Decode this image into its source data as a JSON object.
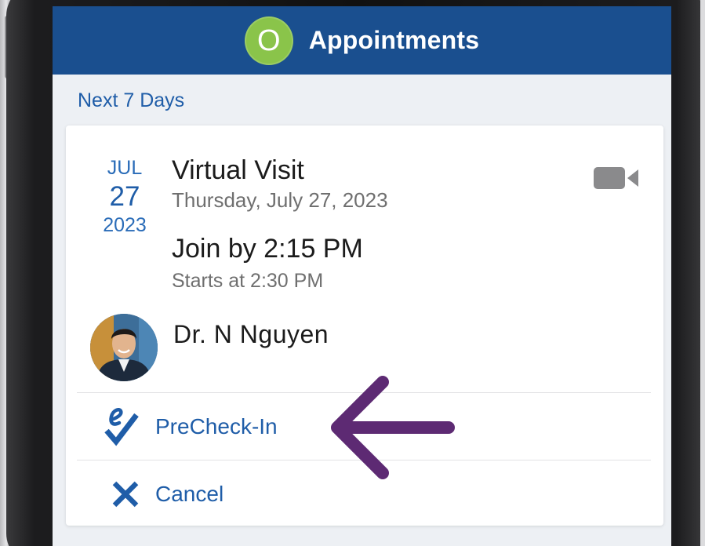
{
  "colors": {
    "brand": "#1a4f8f",
    "logo_green": "#8ac44a",
    "accent_blue": "#1f5da8",
    "annotation_purple": "#5d2a73"
  },
  "header": {
    "logo_letter": "O",
    "title": "Appointments"
  },
  "section": {
    "label": "Next 7 Days"
  },
  "appointment": {
    "month": "JUL",
    "day": "27",
    "year": "2023",
    "visit_type": "Virtual Visit",
    "full_date": "Thursday, July 27, 2023",
    "join_by": "Join by 2:15 PM",
    "starts_at": "Starts at 2:30 PM",
    "visit_icon": "video-camera-icon",
    "provider": {
      "name": "Dr. N Nguyen"
    }
  },
  "actions": [
    {
      "label": "PreCheck-In",
      "icon": "echeckin-icon"
    },
    {
      "label": "Cancel",
      "icon": "close-icon"
    }
  ],
  "annotation": {
    "icon": "arrow-left-icon",
    "color": "#5d2a73"
  }
}
